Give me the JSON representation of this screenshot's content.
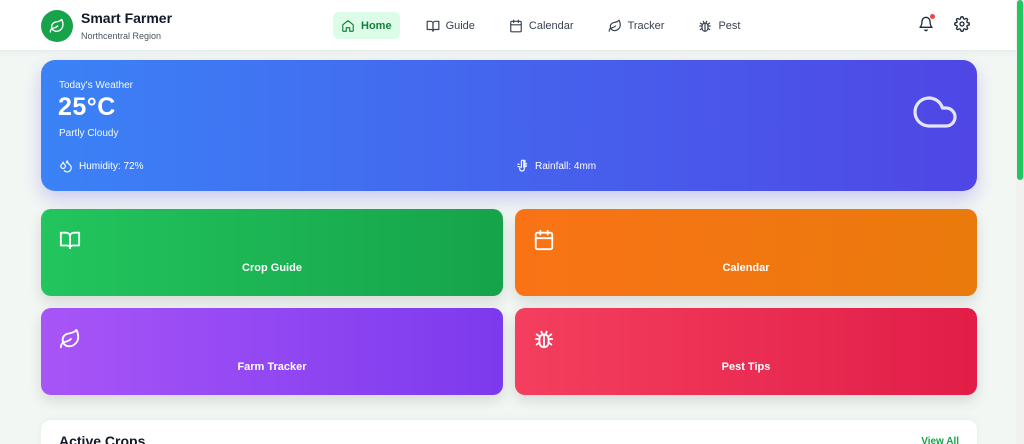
{
  "brand": {
    "title": "Smart Farmer",
    "subtitle": "Northcentral Region",
    "icon": "leaf-icon"
  },
  "nav": [
    {
      "label": "Home",
      "icon": "home-icon",
      "active": true
    },
    {
      "label": "Guide",
      "icon": "book-icon",
      "active": false
    },
    {
      "label": "Calendar",
      "icon": "calendar-icon",
      "active": false
    },
    {
      "label": "Tracker",
      "icon": "leaf-icon",
      "active": false
    },
    {
      "label": "Pest",
      "icon": "bug-icon",
      "active": false
    }
  ],
  "header_actions": {
    "notification_icon": "bell-icon",
    "settings_icon": "gear-icon",
    "has_unread": true
  },
  "weather": {
    "label": "Today's Weather",
    "temperature": "25°C",
    "condition": "Partly Cloudy",
    "humidity": "Humidity: 72%",
    "rainfall": "Rainfall: 4mm",
    "icon": "cloud-icon"
  },
  "cards": [
    {
      "label": "Crop Guide",
      "icon": "book-icon",
      "color": "#16a34a"
    },
    {
      "label": "Calendar",
      "icon": "calendar-icon",
      "color": "#f97316"
    },
    {
      "label": "Farm Tracker",
      "icon": "leaf-icon",
      "color": "#8b5cf6"
    },
    {
      "label": "Pest Tips",
      "icon": "bug-icon",
      "color": "#f43f5e"
    }
  ],
  "active_crops": {
    "title": "Active Crops",
    "view_all": "View All"
  },
  "colors": {
    "primary": "#16a34a",
    "weather_start": "#3b82f6",
    "weather_end": "#4f46e5"
  }
}
